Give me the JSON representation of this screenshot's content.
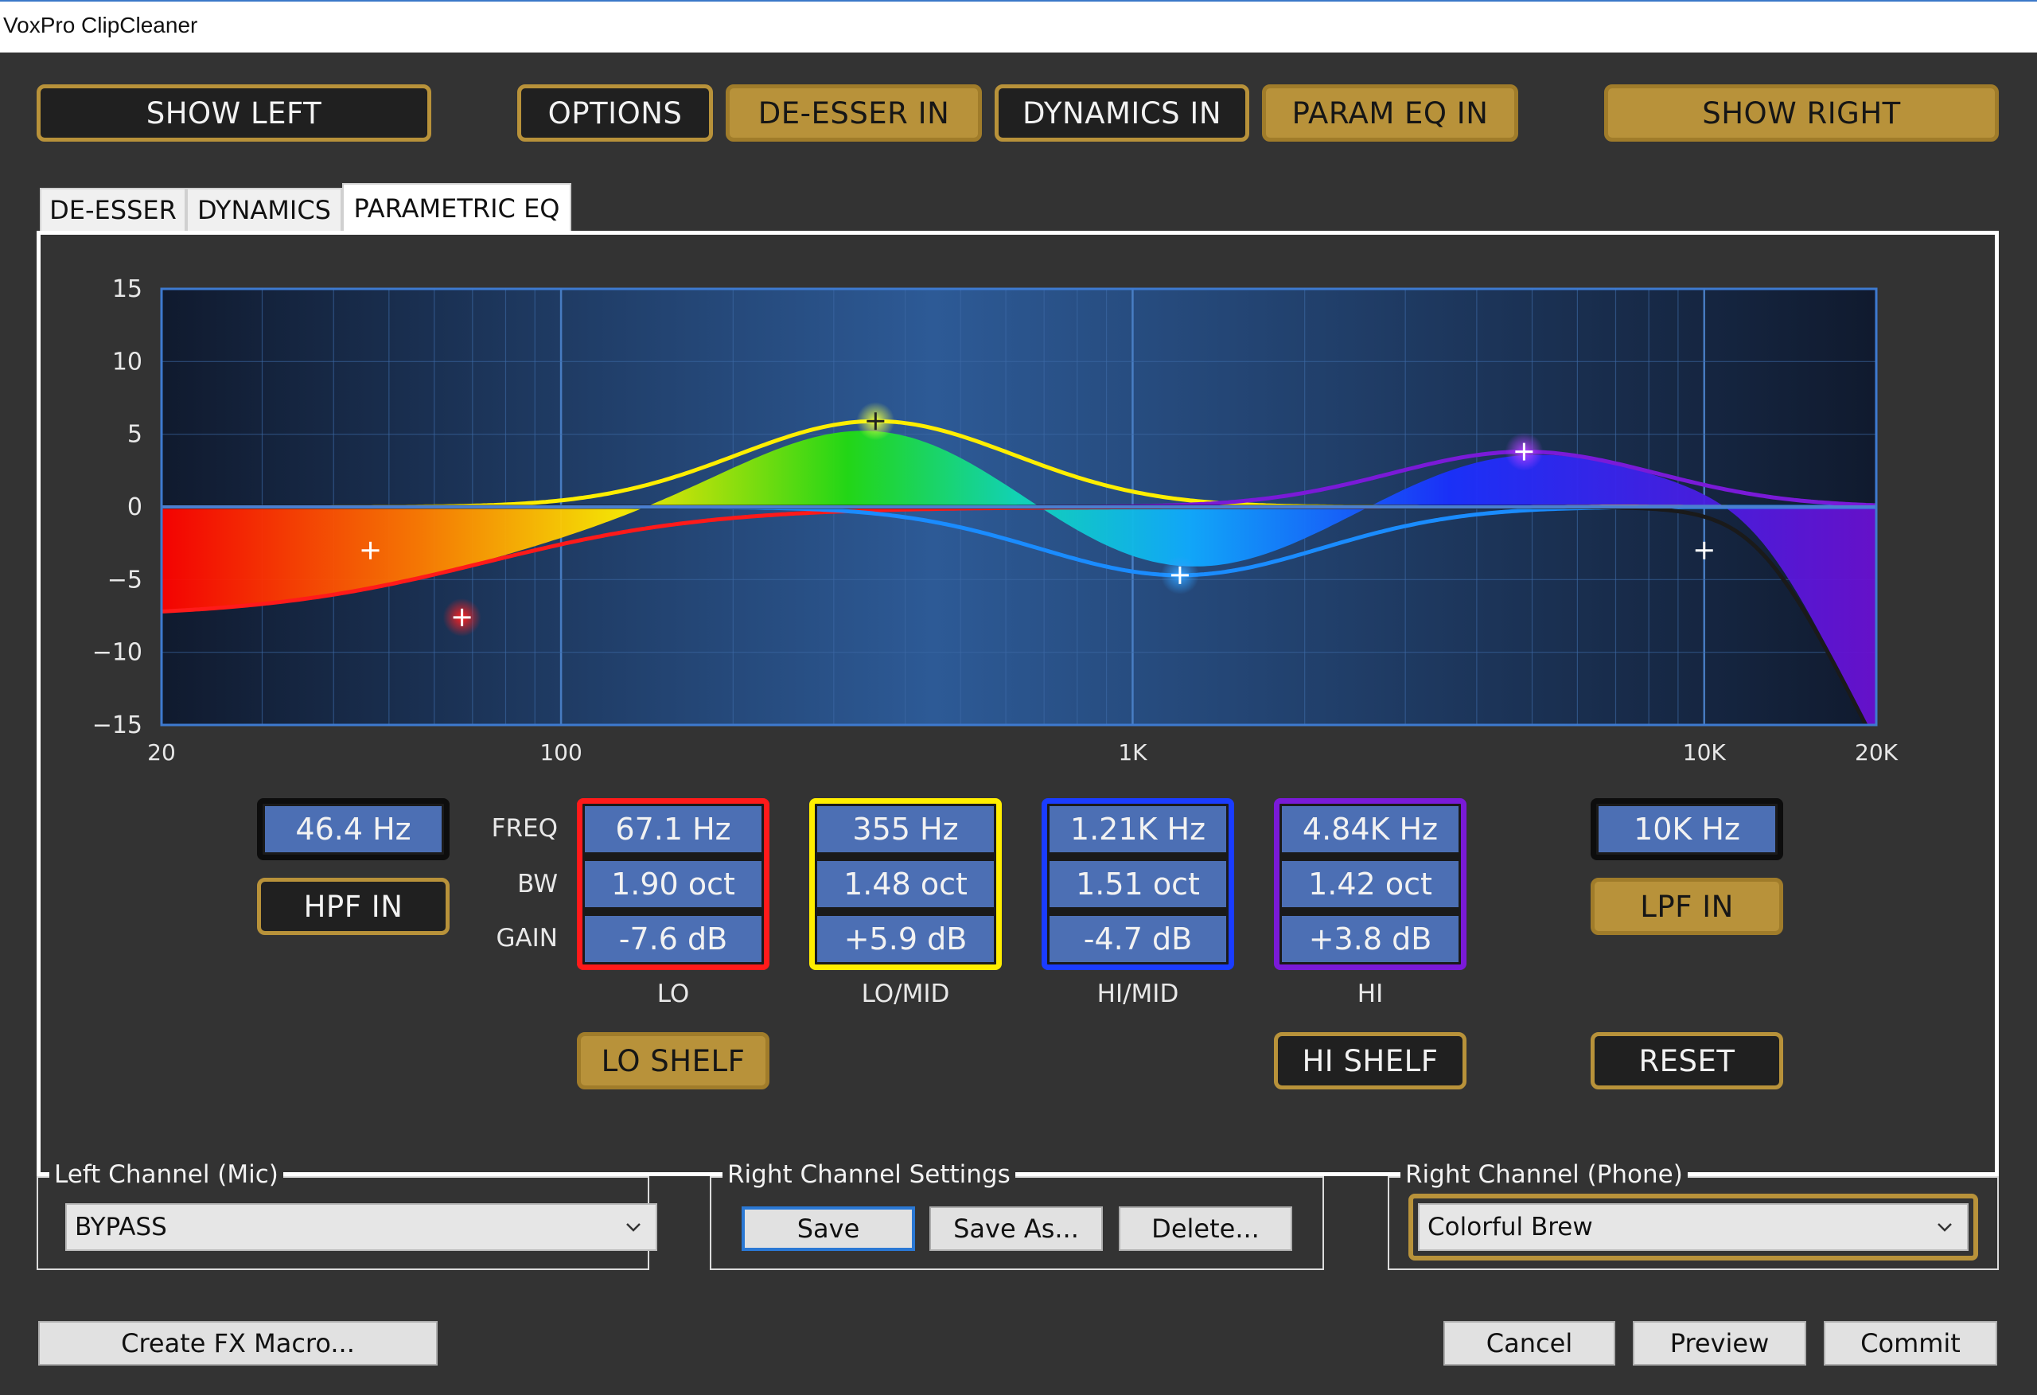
{
  "window": {
    "title": "VoxPro ClipCleaner"
  },
  "top_buttons": {
    "show_left": "SHOW LEFT",
    "options": "OPTIONS",
    "de_esser_in": "DE-ESSER IN",
    "dynamics_in": "DYNAMICS IN",
    "param_eq_in": "PARAM EQ IN",
    "show_right": "SHOW RIGHT"
  },
  "tabs": [
    {
      "label": "DE-ESSER",
      "active": false
    },
    {
      "label": "DYNAMICS",
      "active": false
    },
    {
      "label": "PARAMETRIC EQ",
      "active": true
    }
  ],
  "eq_plot": {
    "y_ticks": [
      "15",
      "10",
      "5",
      "0",
      "-5",
      "-10",
      "-15"
    ],
    "x_ticks": [
      "20",
      "100",
      "1K",
      "10K",
      "20K"
    ],
    "y_range": [
      -15,
      15
    ],
    "x_range_hz": [
      20,
      20000
    ],
    "x_scale": "log",
    "colors": {
      "lo": "#ff1a1a",
      "lo_mid": "#ffee00",
      "hi_mid": "#1a6cff",
      "hi": "#8a1ad8",
      "background": "#1d3a66"
    }
  },
  "eq": {
    "row_labels": {
      "freq": "FREQ",
      "bw": "BW",
      "gain": "GAIN"
    },
    "hpf": {
      "freq": "46.4 Hz",
      "button": "HPF IN"
    },
    "lpf": {
      "freq": "10K Hz",
      "button": "LPF IN"
    },
    "bands": [
      {
        "name": "LO",
        "freq": "67.1 Hz",
        "bw": "1.90 oct",
        "gain": "-7.6 dB",
        "color": "#ff1a1a"
      },
      {
        "name": "LO/MID",
        "freq": "355 Hz",
        "bw": "1.48 oct",
        "gain": "+5.9 dB",
        "color": "#ffee00"
      },
      {
        "name": "HI/MID",
        "freq": "1.21K Hz",
        "bw": "1.51 oct",
        "gain": "-4.7 dB",
        "color": "#1a3cff"
      },
      {
        "name": "HI",
        "freq": "4.84K Hz",
        "bw": "1.42 oct",
        "gain": "+3.8 dB",
        "color": "#7a1ad8"
      }
    ],
    "lo_shelf": "LO SHELF",
    "hi_shelf": "HI SHELF",
    "reset": "RESET"
  },
  "left_channel": {
    "title": "Left Channel (Mic)",
    "value": "BYPASS"
  },
  "right_settings": {
    "title": "Right Channel Settings",
    "save": "Save",
    "save_as": "Save As...",
    "delete": "Delete..."
  },
  "right_channel": {
    "title": "Right Channel (Phone)",
    "value": "Colorful Brew"
  },
  "bottom": {
    "create_macro": "Create FX Macro...",
    "cancel": "Cancel",
    "preview": "Preview",
    "commit": "Commit"
  }
}
